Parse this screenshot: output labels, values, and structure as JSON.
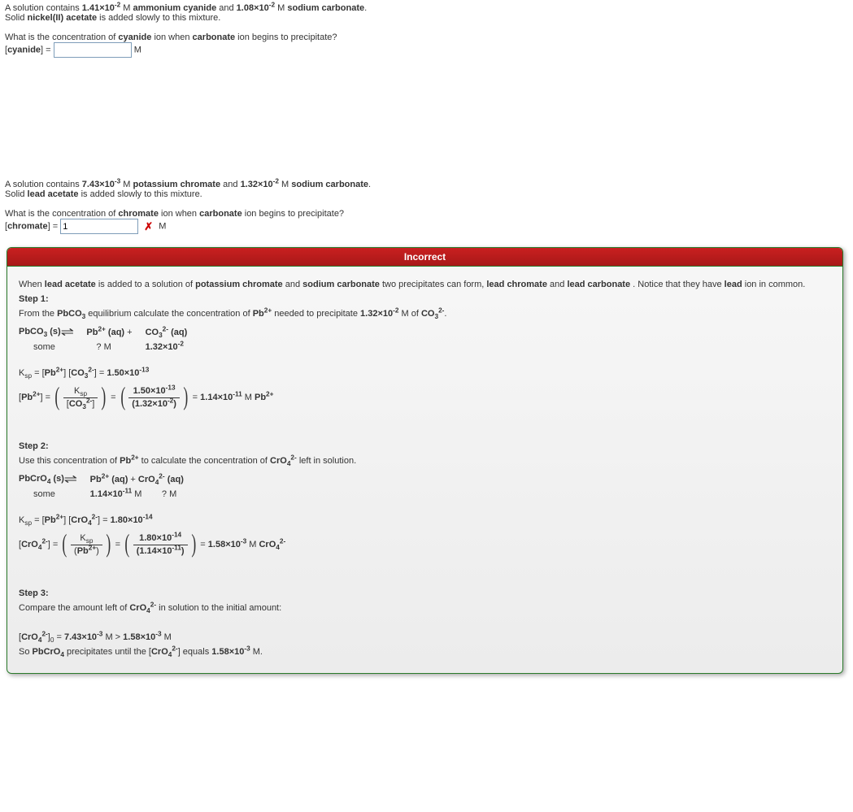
{
  "q1": {
    "intro_pre": "A solution contains ",
    "conc1": "1.41×10",
    "conc1_exp": "-2",
    "molar": " M ",
    "chem1": "ammonium cyanide",
    "mid": " and ",
    "conc2": "1.08×10",
    "conc2_exp": "-2",
    "chem2": "sodium carbonate",
    "intro_post": ".",
    "line2_pre": "Solid ",
    "solid": "nickel(II) acetate",
    "line2_post": " is added slowly to this mixture.",
    "prompt_pre": "What is the concentration of ",
    "target": "cyanide",
    "prompt_mid": " ion when ",
    "trigger": "carbonate",
    "prompt_post": " ion begins to precipitate?",
    "label_pre": "[",
    "label_main": "cyanide",
    "label_post": "] =",
    "value": "",
    "unit": "M"
  },
  "q2": {
    "intro_pre": "A solution contains ",
    "conc1": "7.43×10",
    "conc1_exp": "-3",
    "molar": " M ",
    "chem1": "potassium chromate",
    "mid": " and ",
    "conc2": "1.32×10",
    "conc2_exp": "-2",
    "chem2": "sodium carbonate",
    "intro_post": ".",
    "line2_pre": "Solid ",
    "solid": "lead acetate",
    "line2_post": " is added slowly to this mixture.",
    "prompt_pre": "What is the concentration of ",
    "target": "chromate",
    "prompt_mid": " ion when ",
    "trigger": "carbonate",
    "prompt_post": " ion begins to precipitate?",
    "label_pre": "[",
    "label_main": "chromate",
    "label_post": "] =",
    "value": "1",
    "xmark": "✗",
    "unit": "M"
  },
  "fb": {
    "header": "Incorrect",
    "intro_txt": {
      "t0": "When ",
      "b0": "lead acetate",
      "t1": " is added to a solution of ",
      "b1": "potassium chromate",
      "t2": " and ",
      "b2": "sodium carbonate",
      "t3": " two precipitates can form, ",
      "b3": "lead chromate",
      "t4": " and ",
      "b4": "lead carbonate",
      "t5": ". Notice that they have ",
      "b5": "lead",
      "t6": " ion in common."
    },
    "step1": {
      "title": "Step 1:",
      "line": {
        "t0": "From the ",
        "b0": "PbCO",
        "sub0": "3",
        "t1": " equilibrium calculate the concentration of ",
        "b1": "Pb",
        "sup1": "2+",
        "t2": " needed to precipitate ",
        "b2": "1.32×10",
        "sup2": "-2",
        "t3": " M of ",
        "b3": "CO",
        "sub3": "3",
        "sup3": "2-",
        "t4": "."
      },
      "eq": {
        "lhs": "PbCO",
        "lhs_sub": "3",
        "lhs_state": " (s)",
        "r1": "Pb",
        "r1_sup": "2+",
        "r1_state": " (aq)",
        "plus": " + ",
        "r2": "CO",
        "r2_sub": "3",
        "r2_sup": "2-",
        "r2_state": " (aq)",
        "row2a": "some",
        "row2b": "? M",
        "row2c": "1.32×10",
        "row2c_exp": "-2"
      },
      "ksp": {
        "t0": "K",
        "sub0": "sp",
        "t1": " = [",
        "b1": "Pb",
        "sup1": "2+",
        "t2": "] [",
        "b2": "CO",
        "sub2": "3",
        "sup2": "2-",
        "t3": "] = ",
        "b3": "1.50×10",
        "sup3": "-13"
      },
      "calc": {
        "lhs0": "[",
        "lhs1": "Pb",
        "lhs1_sup": "2+",
        "lhs2": "] = ",
        "num1": "K",
        "num1_sub": "sp",
        "den1_a": "[",
        "den1_b": "CO",
        "den1_sub": "3",
        "den1_sup": "2-",
        "den1_c": "]",
        "eq": " = ",
        "num2": "1.50×10",
        "num2_exp": "-13",
        "den2": "(1.32×10",
        "den2_exp": "-2",
        "den2_end": ")",
        "res_pre": " = ",
        "res": "1.14×10",
        "res_exp": "-11",
        "res_unit": " M ",
        "res_ion": "Pb",
        "res_ion_sup": "2+"
      }
    },
    "step2": {
      "title": "Step 2:",
      "line": {
        "t0": "Use this concentration of ",
        "b0": "Pb",
        "sup0": "2+",
        "t1": " to calculate the concentration of ",
        "b1": "CrO",
        "sub1": "4",
        "sup1": "2-",
        "t2": " left in solution."
      },
      "eq": {
        "lhs": "PbCrO",
        "lhs_sub": "4",
        "lhs_state": " (s)",
        "r1": "Pb",
        "r1_sup": "2+",
        "r1_state": " (aq)",
        "plus": " + ",
        "r2": "CrO",
        "r2_sub": "4",
        "r2_sup": "2-",
        "r2_state": " (aq)",
        "row2a": "some",
        "row2b": "1.14×10",
        "row2b_exp": "-11",
        "row2b_unit": " M",
        "row2c": "? M"
      },
      "ksp": {
        "t0": "K",
        "sub0": "sp",
        "t1": " = [",
        "b1": "Pb",
        "sup1": "2+",
        "t2": "] [",
        "b2": "CrO",
        "sub2": "4",
        "sup2": "2-",
        "t3": "] = ",
        "b3": "1.80×10",
        "sup3": "-14"
      },
      "calc": {
        "lhs0": "[",
        "lhs1": "CrO",
        "lhs1_sub": "4",
        "lhs1_sup": "2-",
        "lhs2": "] = ",
        "num1": "K",
        "num1_sub": "sp",
        "den1_a": "(",
        "den1_b": "Pb",
        "den1_sup": "2+",
        "den1_c": ")",
        "eq": " = ",
        "num2": "1.80×10",
        "num2_exp": "-14",
        "den2": "(1.14×10",
        "den2_exp": "-11",
        "den2_end": ")",
        "res_pre": " = ",
        "res": "1.58×10",
        "res_exp": "-3",
        "res_unit": " M ",
        "res_ion": "CrO",
        "res_ion_sub": "4",
        "res_ion_sup": "2-"
      }
    },
    "step3": {
      "title": "Step 3:",
      "line": {
        "t0": "Compare the amount left of ",
        "b0": "CrO",
        "sub0": "4",
        "sup0": "2-",
        "t1": " in solution to the initial amount:"
      },
      "cmp": {
        "t0": "[",
        "b0": "CrO",
        "sub0": "4",
        "sup0": "2-",
        "t1": "]",
        "sub1": "0",
        "t2": " = ",
        "b2": "7.43×10",
        "sup2": "-3",
        "t3": " M > ",
        "b3": "1.58×10",
        "sup3": "-3",
        "t4": " M"
      },
      "concl": {
        "t0": "So ",
        "b0": "PbCrO",
        "sub0": "4",
        "t1": " precipitates until the [",
        "b1": "CrO",
        "sub1": "4",
        "sup1": "2-",
        "t2": "] equals ",
        "b2": "1.58×10",
        "sup2": "-3",
        "t3": " M."
      }
    }
  }
}
